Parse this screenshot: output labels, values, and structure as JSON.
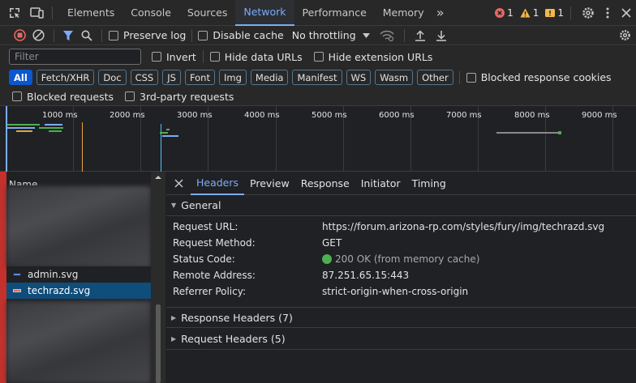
{
  "devtools": {
    "tabs": [
      {
        "label": "Elements"
      },
      {
        "label": "Console"
      },
      {
        "label": "Sources"
      },
      {
        "label": "Network"
      },
      {
        "label": "Performance"
      },
      {
        "label": "Memory"
      }
    ],
    "errors_count": "1",
    "warnings_count": "1",
    "issues_count": "1"
  },
  "toolbar": {
    "preserve_log": "Preserve log",
    "disable_cache": "Disable cache",
    "throttling": "No throttling"
  },
  "filter": {
    "placeholder": "Filter",
    "invert": "Invert",
    "hide_data_urls": "Hide data URLs",
    "hide_extension_urls": "Hide extension URLs"
  },
  "types": [
    "All",
    "Fetch/XHR",
    "Doc",
    "CSS",
    "JS",
    "Font",
    "Img",
    "Media",
    "Manifest",
    "WS",
    "Wasm",
    "Other"
  ],
  "blocked_response_cookies": "Blocked response cookies",
  "blocked_requests": "Blocked requests",
  "third_party_requests": "3rd-party requests",
  "overview": {
    "ticks": [
      "1000 ms",
      "2000 ms",
      "3000 ms",
      "4000 ms",
      "5000 ms",
      "6000 ms",
      "7000 ms",
      "8000 ms",
      "9000 ms"
    ]
  },
  "request_list": {
    "header": "Name",
    "rows": [
      {
        "name": "admin.svg"
      },
      {
        "name": "techrazd.svg"
      }
    ]
  },
  "detail": {
    "tabs": [
      "Headers",
      "Preview",
      "Response",
      "Initiator",
      "Timing"
    ],
    "general_title": "General",
    "general": [
      {
        "key": "Request URL:",
        "value": "https://forum.arizona-rp.com/styles/fury/img/techrazd.svg"
      },
      {
        "key": "Request Method:",
        "value": "GET"
      },
      {
        "key": "Status Code:",
        "value": "200 OK (from memory cache)"
      },
      {
        "key": "Remote Address:",
        "value": "87.251.65.15:443"
      },
      {
        "key": "Referrer Policy:",
        "value": "strict-origin-when-cross-origin"
      }
    ],
    "response_headers": "Response Headers (7)",
    "request_headers": "Request Headers (5)"
  },
  "colors": {
    "accent": "#7cacf8",
    "active_chip": "#0b57d0",
    "status_ok": "#4caf50",
    "error": "#e46962",
    "warning": "#f2b84b"
  }
}
